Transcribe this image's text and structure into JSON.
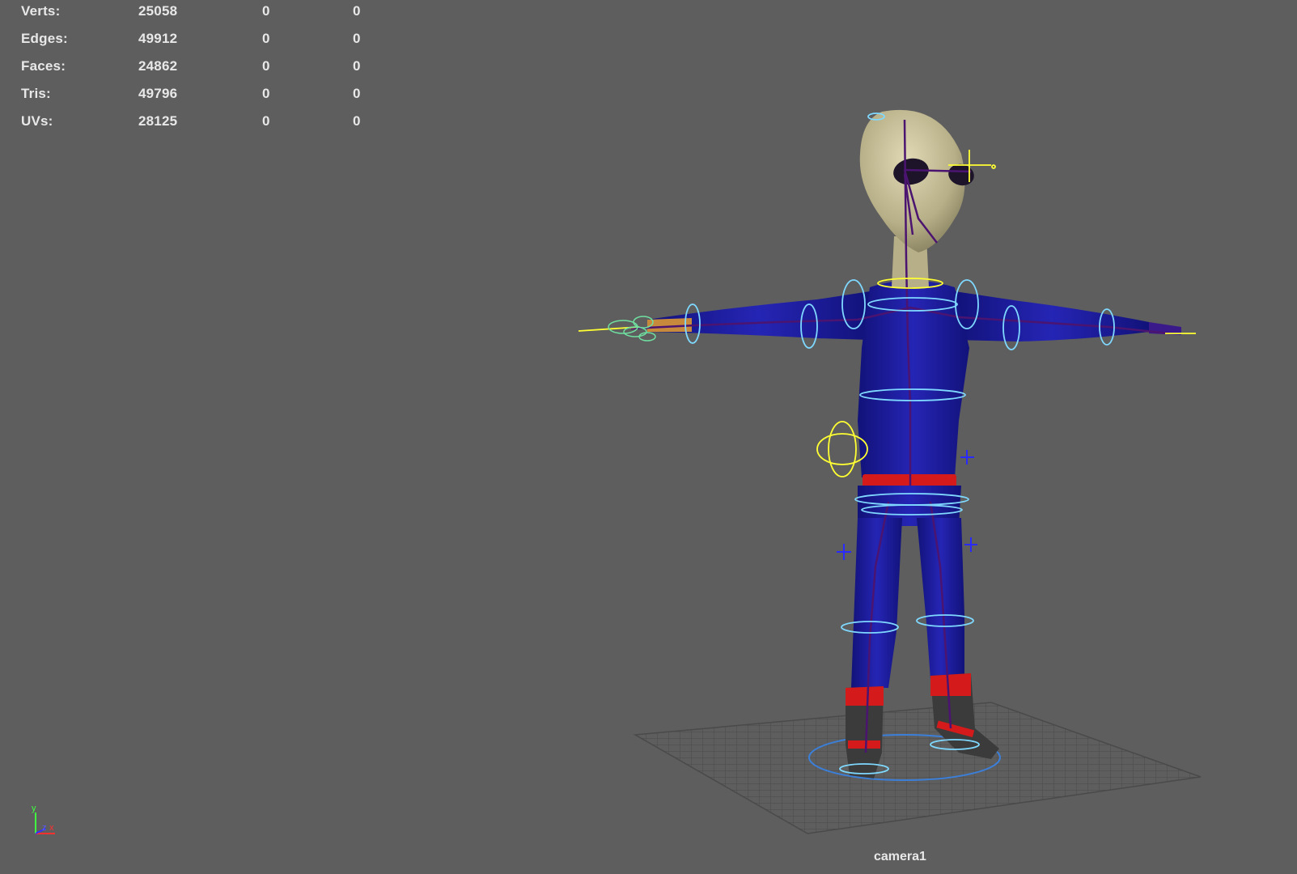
{
  "hud": {
    "rows": [
      {
        "label": "Verts:",
        "v1": "25058",
        "v2": "0",
        "v3": "0"
      },
      {
        "label": "Edges:",
        "v1": "49912",
        "v2": "0",
        "v3": "0"
      },
      {
        "label": "Faces:",
        "v1": "24862",
        "v2": "0",
        "v3": "0"
      },
      {
        "label": "Tris:",
        "v1": "49796",
        "v2": "0",
        "v3": "0"
      },
      {
        "label": "UVs:",
        "v1": "28125",
        "v2": "0",
        "v3": "0"
      }
    ]
  },
  "camera": {
    "name": "camera1"
  },
  "axis": {
    "y": "y",
    "z": "z",
    "x": "x"
  },
  "colors": {
    "background": "#5e5e5e",
    "hud_text": "#e8e8e8",
    "rig_curves": "#7fd8ff",
    "suit": "#1a1a9e",
    "head": "#c9c19a",
    "belt": "#d41a1a",
    "selection": "#ffff33"
  }
}
